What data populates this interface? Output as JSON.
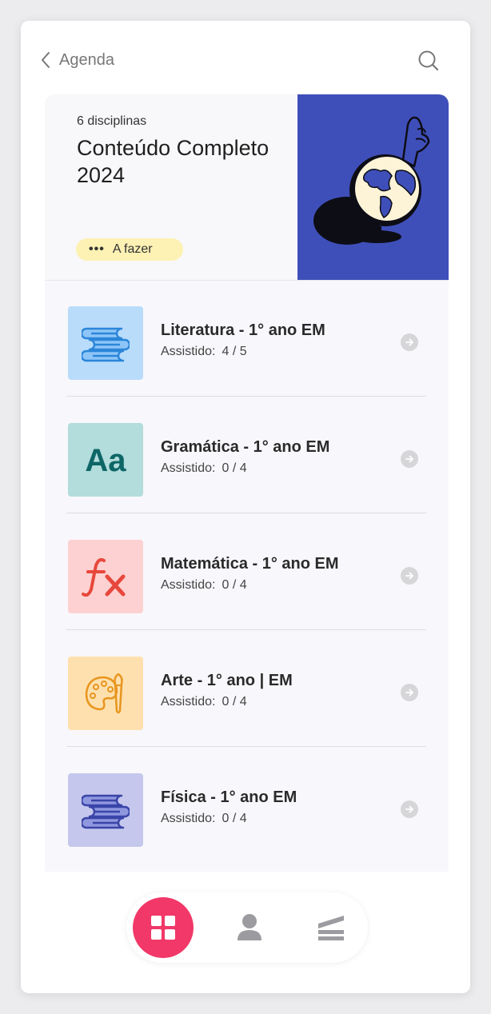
{
  "header": {
    "back_label": "Agenda"
  },
  "course": {
    "count": "6 disciplinas",
    "title": "Conteúdo Completo 2024",
    "status": "A fazer",
    "status_dots": "•••"
  },
  "subjects": [
    {
      "name": "Literatura - 1° ano EM",
      "progress_label": "Assistido:",
      "progress": "4 / 5",
      "icon": "books-icon",
      "color": "#b9dcfb"
    },
    {
      "name": "Gramática - 1° ano EM",
      "progress_label": "Assistido:",
      "progress": "0 / 4",
      "icon": "font-aa-icon",
      "color": "#b3dcdc"
    },
    {
      "name": "Matemática - 1° ano EM",
      "progress_label": "Assistido:",
      "progress": "0 / 4",
      "icon": "function-fx-icon",
      "color": "#fdd1d1"
    },
    {
      "name": "Arte - 1° ano | EM",
      "progress_label": "Assistido:",
      "progress": "0 / 4",
      "icon": "palette-icon",
      "color": "#fee0ae"
    },
    {
      "name": "Física - 1° ano EM",
      "progress_label": "Assistido:",
      "progress": "0 / 4",
      "icon": "books-icon",
      "color": "#c5c8ec"
    }
  ],
  "nav": [
    "grid-icon",
    "user-icon",
    "layers-icon"
  ],
  "colors": {
    "accent": "#f13868",
    "hero_art": "#3f4fb9",
    "badge": "#fdf1b3"
  }
}
